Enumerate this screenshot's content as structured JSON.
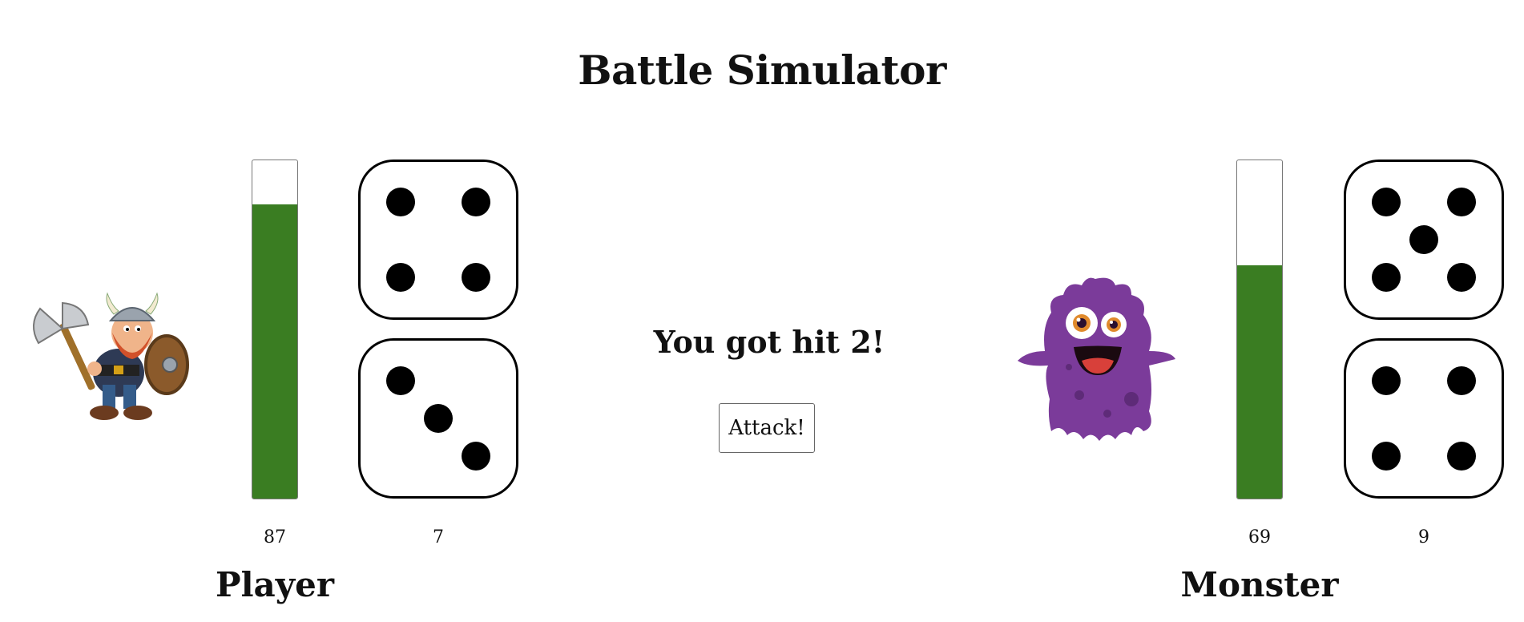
{
  "title": "Battle Simulator",
  "message": "You got hit 2!",
  "attack_label": "Attack!",
  "player": {
    "label": "Player",
    "health": 87,
    "health_max": 100,
    "health_color": "#3a7d22",
    "dice": [
      4,
      3
    ],
    "dice_total": "7",
    "health_text": "87"
  },
  "monster": {
    "label": "Monster",
    "health": 69,
    "health_max": 100,
    "health_color": "#3a7d22",
    "dice": [
      5,
      4
    ],
    "dice_total": "9",
    "health_text": "69"
  }
}
